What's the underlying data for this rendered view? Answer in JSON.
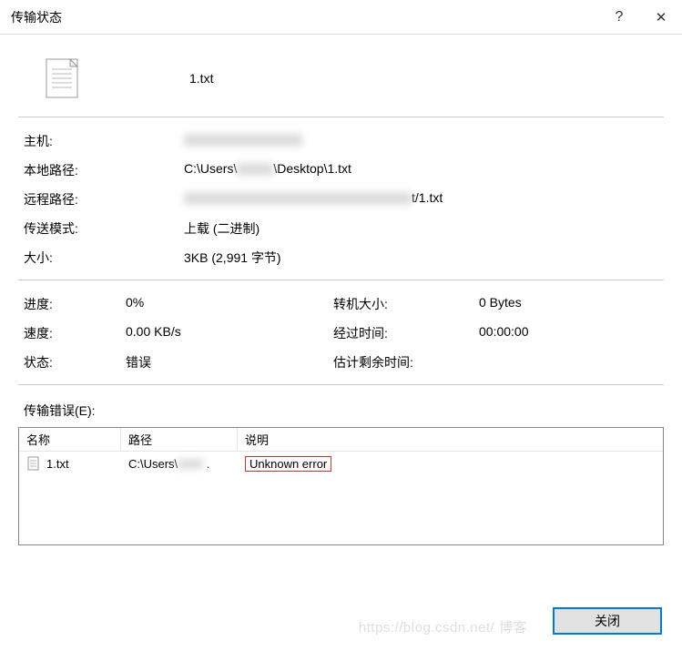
{
  "titlebar": {
    "title": "传输状态",
    "help": "?",
    "close_glyph": "✕"
  },
  "file": {
    "name": "1.txt"
  },
  "info": {
    "host_label": "主机:",
    "host_value": "",
    "local_path_label": "本地路径:",
    "local_path_prefix": "C:\\Users\\",
    "local_path_suffix": "\\Desktop\\1.txt",
    "remote_path_label": "远程路径:",
    "remote_path_suffix": "t/1.txt",
    "mode_label": "传送模式:",
    "mode_value": "上载 (二进制)",
    "size_label": "大小:",
    "size_value": "3KB (2,991 字节)"
  },
  "progress": {
    "progress_label": "进度:",
    "progress_value": "0%",
    "transfer_size_label": "转机大小:",
    "transfer_size_value": "0 Bytes",
    "speed_label": "速度:",
    "speed_value": "0.00 KB/s",
    "elapsed_label": "经过时间:",
    "elapsed_value": "00:00:00",
    "status_label": "状态:",
    "status_value": "错误",
    "eta_label": "估计剩余时间:",
    "eta_value": ""
  },
  "errors": {
    "section_label": "传输错误(E):",
    "col_name": "名称",
    "col_path": "路径",
    "col_desc": "说明",
    "rows": [
      {
        "name": "1.txt",
        "path_prefix": "C:\\Users\\",
        "path_suffix": ".",
        "desc": "Unknown error"
      }
    ]
  },
  "footer": {
    "close_label": "关闭"
  },
  "watermark": "https://blog.csdn.net/     博客"
}
